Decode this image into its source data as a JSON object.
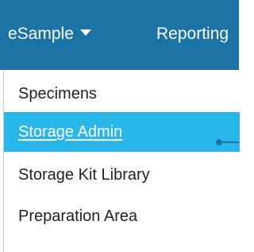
{
  "navbar": {
    "items": [
      {
        "label": "eSample",
        "has_dropdown": true
      },
      {
        "label": "Reporting"
      }
    ],
    "background": "#1b73a6"
  },
  "dropdown": {
    "items": [
      {
        "label": "Specimens",
        "active": false
      },
      {
        "label": "Storage Admin",
        "active": true
      },
      {
        "label": "Storage Kit Library",
        "active": false
      },
      {
        "label": "Preparation Area",
        "active": false
      }
    ],
    "highlight_color": "#29b6e8"
  },
  "callout": {
    "color": "#1b73a6"
  }
}
